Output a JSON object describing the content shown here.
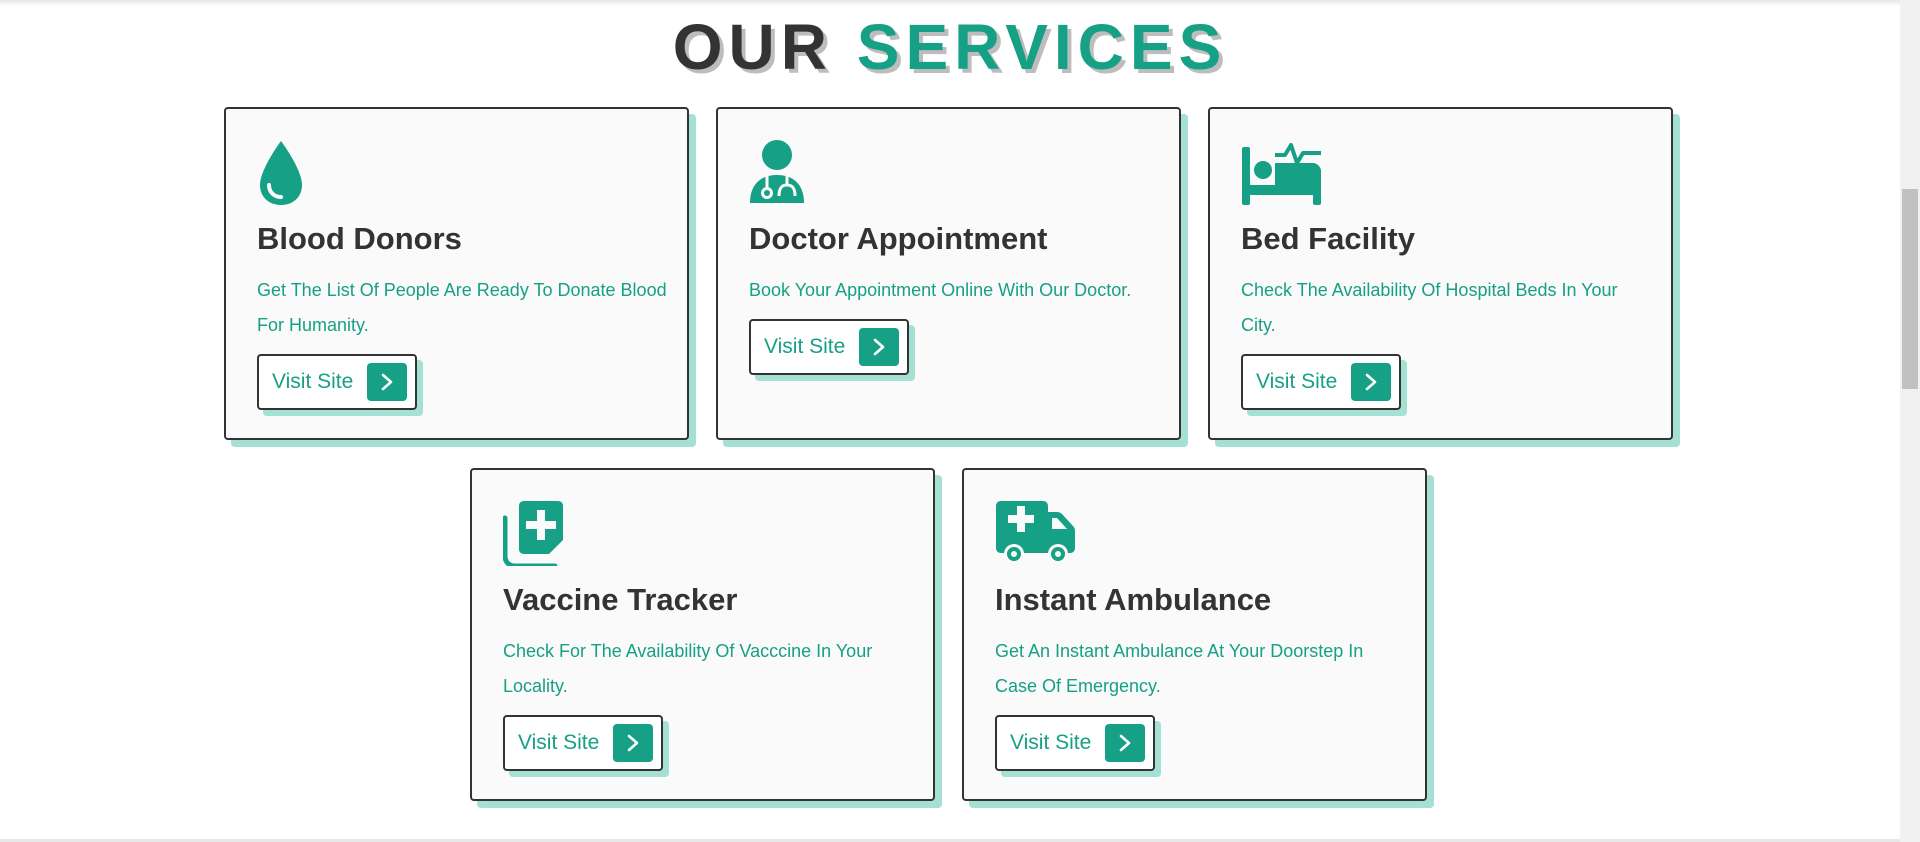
{
  "section": {
    "title_part1": "OUR",
    "title_part2": "SERVICES"
  },
  "colors": {
    "accent": "#16a085",
    "accent_shadow": "#a5e0d4",
    "text_dark": "#333333",
    "card_bg": "#fafafa"
  },
  "cards": [
    {
      "icon": "blood-drop-icon",
      "title": "Blood Donors",
      "description": "Get The List Of People Are Ready To Donate Blood For Humanity.",
      "button_label": "Visit Site"
    },
    {
      "icon": "doctor-icon",
      "title": "Doctor Appointment",
      "description": "Book Your Appointment Online With Our Doctor.",
      "button_label": "Visit Site"
    },
    {
      "icon": "hospital-bed-icon",
      "title": "Bed Facility",
      "description": "Check The Availability Of Hospital Beds In Your City.",
      "button_label": "Visit Site"
    },
    {
      "icon": "medical-kit-icon",
      "title": "Vaccine Tracker",
      "description": "Check For The Availability Of Vacccine In Your Locality.",
      "button_label": "Visit Site"
    },
    {
      "icon": "ambulance-icon",
      "title": "Instant Ambulance",
      "description": "Get An Instant Ambulance At Your Doorstep In Case Of Emergency.",
      "button_label": "Visit Site"
    }
  ]
}
